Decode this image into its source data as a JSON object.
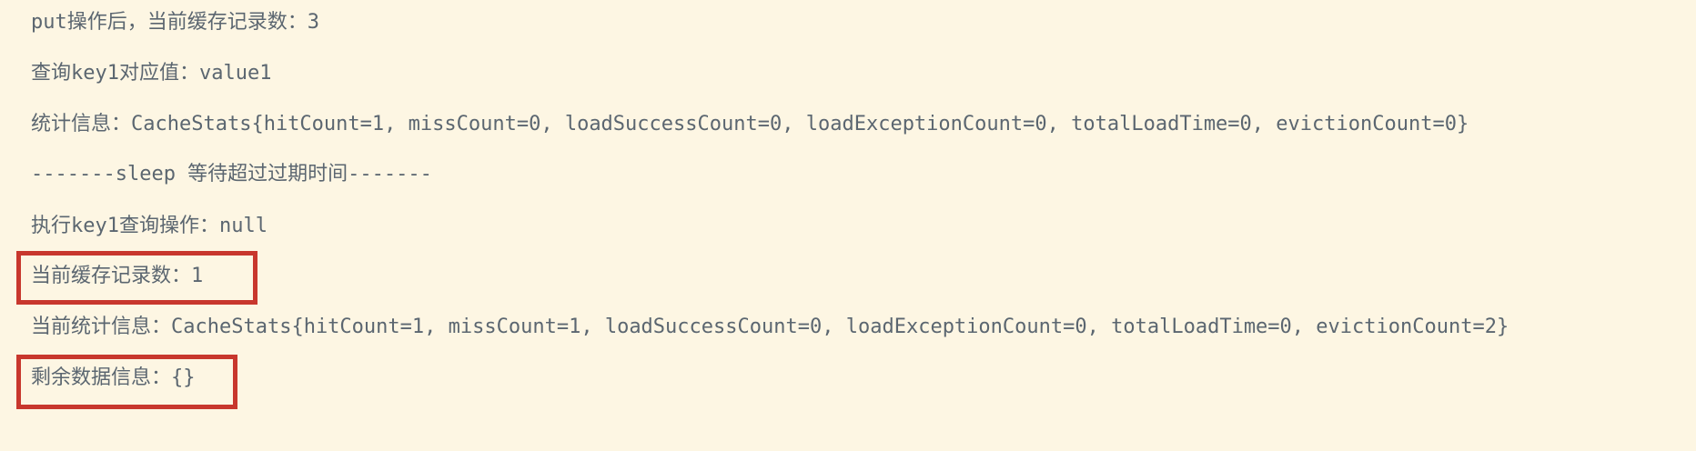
{
  "console": {
    "lines": [
      "put操作后，当前缓存记录数：3",
      "查询key1对应值：value1",
      "统计信息：CacheStats{hitCount=1, missCount=0, loadSuccessCount=0, loadExceptionCount=0, totalLoadTime=0, evictionCount=0}",
      "-------sleep 等待超过过期时间-------",
      "执行key1查询操作：null",
      "当前缓存记录数：1",
      "当前统计信息：CacheStats{hitCount=1, missCount=1, loadSuccessCount=0, loadExceptionCount=0, totalLoadTime=0, evictionCount=2}",
      "剩余数据信息：{}"
    ]
  },
  "colors": {
    "background": "#fdf6e3",
    "text": "#5b6670",
    "highlight_border": "#c8372d"
  }
}
